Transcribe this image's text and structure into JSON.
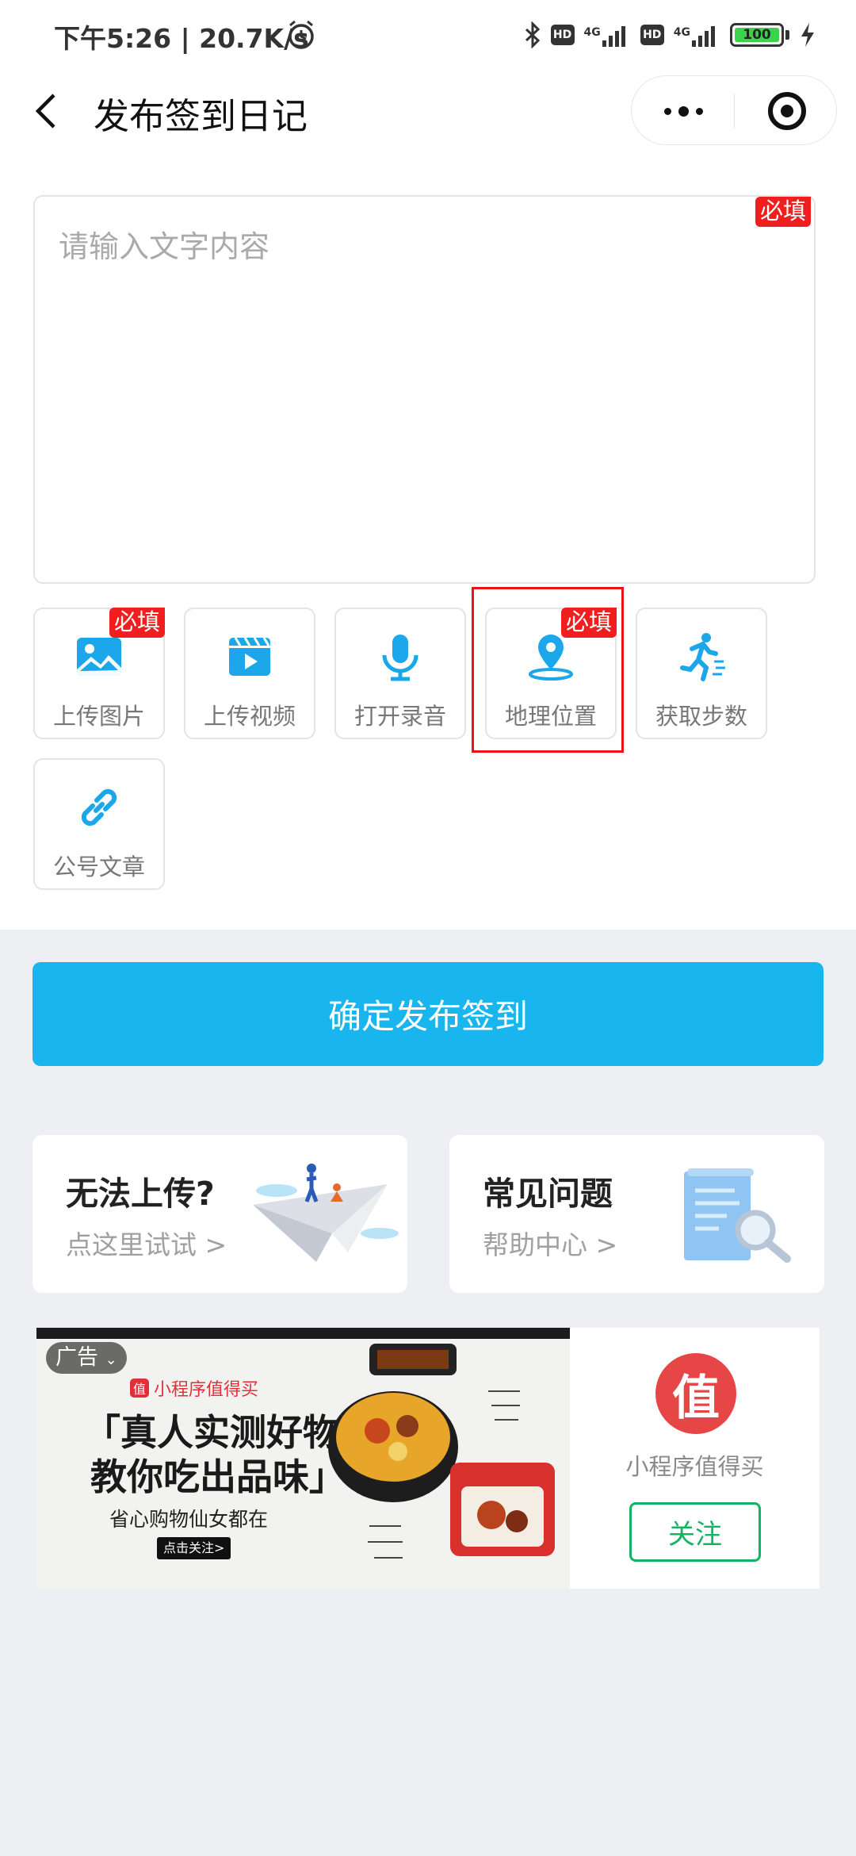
{
  "status_bar": {
    "time": "下午5:26 | 20.7K/s",
    "hd_1": "HD",
    "net_1": "4G",
    "hd_2": "HD",
    "net_2": "4G",
    "battery": "100"
  },
  "nav": {
    "title": "发布签到日记"
  },
  "editor": {
    "placeholder": "请输入文字内容",
    "required_label": "必填"
  },
  "tools": [
    {
      "label": "上传图片",
      "required": "必填",
      "icon": "image-icon"
    },
    {
      "label": "上传视频",
      "required": "",
      "icon": "video-icon"
    },
    {
      "label": "打开录音",
      "required": "",
      "icon": "microphone-icon"
    },
    {
      "label": "地理位置",
      "required": "必填",
      "icon": "location-pin-icon"
    },
    {
      "label": "获取步数",
      "required": "",
      "icon": "running-icon"
    },
    {
      "label": "公号文章",
      "required": "",
      "icon": "link-icon"
    }
  ],
  "publish_button": "确定发布签到",
  "help_cards": [
    {
      "title": "无法上传?",
      "subtitle": "点这里试试 >"
    },
    {
      "title": "常见问题",
      "subtitle": "帮助中心 >"
    }
  ],
  "ad": {
    "tag": "广告",
    "brand": "小程序值得买",
    "headline_1": "「真人实测好物",
    "headline_2": "教你吃出品味」",
    "subline": "省心购物仙女都在",
    "cta": "点击关注>",
    "brand_logo_char": "值",
    "advertiser_name": "小程序值得买",
    "follow_label": "关注"
  },
  "colors": {
    "primary_blue": "#18b5ef",
    "required_red": "#f01e1e",
    "follow_green": "#15b362",
    "icon_blue": "#1ba7e9"
  }
}
